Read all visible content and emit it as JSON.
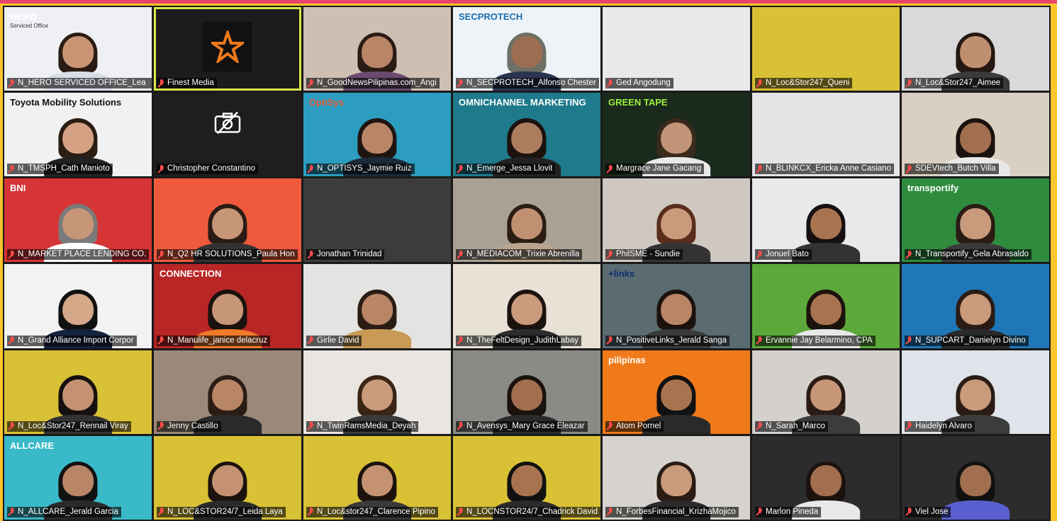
{
  "meeting": {
    "tiles": [
      {
        "name": "N_HERO SERVICED OFFICE_Lea S",
        "bg": "#eef0f4",
        "skin": "#c99474",
        "hair": "#2a1c14",
        "shirt": "#d9dde6",
        "overlay": "HERO",
        "overlay_sub": "Serviced Office"
      },
      {
        "name": "Finest Media",
        "bg": "#1c1c1c",
        "logo": "star",
        "active": true
      },
      {
        "name": "N_GoodNewsPilipinas.com_Angi",
        "bg": "#cdbfb2",
        "skin": "#b98567",
        "hair": "#2a1b14",
        "shirt": "#6a4a6e"
      },
      {
        "name": "N_SECPROTECH_Alfonso Chester",
        "bg": "#eef3f8",
        "skin": "#9c6d50",
        "hair": "#6e6f66",
        "shirt": "#2a3550",
        "overlay": "SECPROTECH",
        "overlay_color": "#1d6fae"
      },
      {
        "name": "Ged Angodung",
        "bg": "#e9e9e9",
        "empty": true
      },
      {
        "name": "N_Loc&Stor247_Queni",
        "bg": "#d9c135",
        "empty": true
      },
      {
        "name": "N_Loc&Stor247_Aimee",
        "bg": "#d9d9d9",
        "skin": "#c08f70",
        "hair": "#231711",
        "shirt": "#3a3a3a"
      },
      {
        "name": "N_TMSPH_Cath Manioto",
        "bg": "#f1f1f1",
        "skin": "#d4a184",
        "hair": "#2c1d14",
        "shirt": "#222222",
        "overlay": "Toyota Mobility Solutions",
        "overlay_color": "#111"
      },
      {
        "name": "Christopher Constantino",
        "bg": "#1e1e1e",
        "camoff": true
      },
      {
        "name": "N_OPTISYS_Jaymie Ruiz",
        "bg": "#2c9dc0",
        "skin": "#b98567",
        "hair": "#1f1510",
        "shirt": "#1c2a3a",
        "overlay": "OptiSys",
        "overlay_color": "#e85d3a"
      },
      {
        "name": "N_Emerge_Jessa Llovit",
        "bg": "#1f7a8c",
        "skin": "#ad7c5f",
        "hair": "#1c120d",
        "shirt": "#222",
        "overlay": "OMNICHANNEL MARKETING",
        "overlay_color": "#fff"
      },
      {
        "name": "Margrace Jane Gacang",
        "bg": "#1a2a1c",
        "skin": "#c2947a",
        "hair": "#3a2a1c",
        "shirt": "#e9e9e9",
        "overlay": "GREEN TAPE",
        "overlay_color": "#9ef03f"
      },
      {
        "name": "N_BLINKCX_Ericka Anne Casiano",
        "bg": "#e4e4e6",
        "empty": true
      },
      {
        "name": "SDEVtech_Butch Villa",
        "bg": "#d9cfc2",
        "skin": "#a16f4f",
        "hair": "#1a120c",
        "shirt": "#e8e8e8"
      },
      {
        "name": "N_MARKET PLACE LENDING CO.",
        "bg": "#d63435",
        "skin": "#c79577",
        "hair": "#7a7a7a",
        "shirt": "#ffffff",
        "overlay": "BNI",
        "overlay_color": "#fff"
      },
      {
        "name": "N_Q2 HR SOLUTIONS_Paula Hon",
        "bg": "#ef5a3c",
        "skin": "#c79577",
        "hair": "#2a1c14",
        "shirt": "#333333"
      },
      {
        "name": "Jonathan Trinidad",
        "bg": "#3c3c3c",
        "empty": true
      },
      {
        "name": "N_MEDIACOM_Trixie Abrenilla",
        "bg": "#a9a193",
        "skin": "#c19072",
        "hair": "#2c1d14",
        "shirt": "#b9a48d"
      },
      {
        "name": "PhilSME - Sundie",
        "bg": "#cfc8c0",
        "skin": "#c99a7c",
        "hair": "#5a2e1c",
        "shirt": "#333333"
      },
      {
        "name": "Jonuel Bato",
        "bg": "#e8e9ea",
        "skin": "#a8744f",
        "hair": "#161010",
        "shirt": "#333333"
      },
      {
        "name": "N_Transportify_Gela Abrasaldo",
        "bg": "#2f8c3f",
        "skin": "#c99a7c",
        "hair": "#2a1c14",
        "shirt": "#3a3a3a",
        "overlay": "transportify",
        "overlay_color": "#fff"
      },
      {
        "name": "N_Grand Alliance Import Corpor",
        "bg": "#f2f2f2",
        "skin": "#d4a888",
        "hair": "#111111",
        "shirt": "#15233f"
      },
      {
        "name": "N_Manulife_janice delacruz",
        "bg": "#b82626",
        "skin": "#c79577",
        "hair": "#1a120c",
        "shirt": "#f07a2a",
        "overlay": "CONNECTION",
        "overlay_color": "#fff"
      },
      {
        "name": "Girlie David",
        "bg": "#e3e3e1",
        "skin": "#b98567",
        "hair": "#2a1c14",
        "shirt": "#c99a55"
      },
      {
        "name": "N_TheFeltDesign_JudithLabay",
        "bg": "#e8e1d6",
        "skin": "#c99a7c",
        "hair": "#1c120d",
        "shirt": "#2c2c2c"
      },
      {
        "name": "N_PositiveLinks_Jerald Sanga",
        "bg": "#5a6b72",
        "skin": "#b98567",
        "hair": "#1c120d",
        "shirt": "#3a3a3a",
        "overlay": "+links",
        "overlay_color": "#0e2d6e"
      },
      {
        "name": "Ervannie Jay Belarmino, CPA",
        "bg": "#5da83a",
        "skin": "#a8744f",
        "hair": "#1c120d",
        "shirt": "#e8e8e8"
      },
      {
        "name": "N_SUPCART_Danielyn Divino",
        "bg": "#1f77b8",
        "skin": "#c99a7c",
        "hair": "#2a1c14",
        "shirt": "#2a2a2a"
      },
      {
        "name": "N_Loc&Stor247_Rennail Viray",
        "bg": "#d9c135",
        "skin": "#c49272",
        "hair": "#161010",
        "shirt": "#333333"
      },
      {
        "name": "Jenny Castillo",
        "bg": "#9a8878",
        "skin": "#b98567",
        "hair": "#2a1c14",
        "shirt": "#2a2a2a"
      },
      {
        "name": "N_TwinRamsMedia_Deyah",
        "bg": "#e9e5e1",
        "skin": "#c99a7c",
        "hair": "#3a2414",
        "shirt": "#3a3a3a"
      },
      {
        "name": "N_Avensys_Mary Grace Eleazar",
        "bg": "#8a8a86",
        "skin": "#a16f4f",
        "hair": "#1a120c",
        "shirt": "#2a2a2a"
      },
      {
        "name": "Atom Pornel",
        "bg": "#f07a1a",
        "skin": "#a8744f",
        "hair": "#111111",
        "shirt": "#2a2a2a",
        "overlay": "pilipinas",
        "overlay_color": "#fff"
      },
      {
        "name": "N_Sarah_Marco",
        "bg": "#d4d1cc",
        "skin": "#c79577",
        "hair": "#2a1c14",
        "shirt": "#3c3c3c"
      },
      {
        "name": "Haidelyn Alvaro",
        "bg": "#dfe4ea",
        "skin": "#c99a7c",
        "hair": "#2a1c14",
        "shirt": "#3c3c3c"
      },
      {
        "name": "N_ALLCARE_Jerald Garcia",
        "bg": "#3ab9c8",
        "skin": "#b98567",
        "hair": "#111111",
        "shirt": "#2a2a2a",
        "overlay": "ALLCARE",
        "overlay_color": "#fff"
      },
      {
        "name": "N_LOC&STOR24/7_Leida Laya",
        "bg": "#d9c135",
        "skin": "#c49272",
        "hair": "#1c120d",
        "shirt": "#2a2a2a"
      },
      {
        "name": "N_Loc&stor247_Clarence Pipino",
        "bg": "#d9c135",
        "skin": "#c49272",
        "hair": "#1c120d",
        "shirt": "#3a3a3a"
      },
      {
        "name": "N_LOCNSTOR24/7_Chadrick David",
        "bg": "#d9c135",
        "skin": "#a8744f",
        "hair": "#111111",
        "shirt": "#2a2a2a"
      },
      {
        "name": "N_ForbesFinancial_KrizhaMojico",
        "bg": "#d6d3cf",
        "skin": "#c99a7c",
        "hair": "#2a1c14",
        "shirt": "#2a2a2a"
      },
      {
        "name": "Marlon Pineda",
        "bg": "#2c2c2c",
        "skin": "#a16f4f",
        "hair": "#1c120d",
        "shirt": "#e8e8e8"
      },
      {
        "name": "Viel Jose",
        "bg": "#2c2c2c",
        "skin": "#a16f4f",
        "hair": "#111111",
        "shirt": "#5a5fd0"
      }
    ]
  }
}
